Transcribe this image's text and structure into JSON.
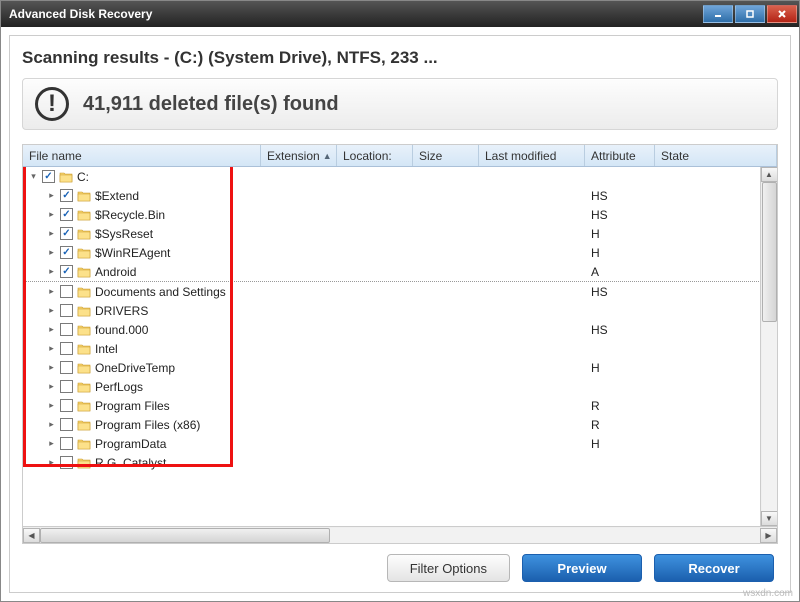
{
  "window": {
    "title": "Advanced Disk Recovery"
  },
  "heading": "Scanning results - (C:)  (System Drive), NTFS, 233 ...",
  "summary": "41,911 deleted file(s) found",
  "columns": {
    "name": "File name",
    "ext": "Extension",
    "loc": "Location:",
    "size": "Size",
    "mod": "Last modified",
    "attr": "Attribute",
    "state": "State"
  },
  "rows": [
    {
      "indent": 0,
      "expander": "▾",
      "checked": true,
      "name": "C:",
      "attr": ""
    },
    {
      "indent": 1,
      "expander": "▸",
      "checked": true,
      "name": "$Extend",
      "attr": "HS"
    },
    {
      "indent": 1,
      "expander": "▸",
      "checked": true,
      "name": "$Recycle.Bin",
      "attr": "HS"
    },
    {
      "indent": 1,
      "expander": "▸",
      "checked": true,
      "name": "$SysReset",
      "attr": "H"
    },
    {
      "indent": 1,
      "expander": "▸",
      "checked": true,
      "name": "$WinREAgent",
      "attr": "H"
    },
    {
      "indent": 1,
      "expander": "▸",
      "checked": true,
      "name": "Android",
      "attr": "A",
      "sep": true
    },
    {
      "indent": 1,
      "expander": "▸",
      "checked": false,
      "name": "Documents and Settings",
      "attr": "HS"
    },
    {
      "indent": 1,
      "expander": "▸",
      "checked": false,
      "name": "DRIVERS",
      "attr": ""
    },
    {
      "indent": 1,
      "expander": "▸",
      "checked": false,
      "name": "found.000",
      "attr": "HS"
    },
    {
      "indent": 1,
      "expander": "▸",
      "checked": false,
      "name": "Intel",
      "attr": ""
    },
    {
      "indent": 1,
      "expander": "▸",
      "checked": false,
      "name": "OneDriveTemp",
      "attr": "H"
    },
    {
      "indent": 1,
      "expander": "▸",
      "checked": false,
      "name": "PerfLogs",
      "attr": ""
    },
    {
      "indent": 1,
      "expander": "▸",
      "checked": false,
      "name": "Program Files",
      "attr": "R"
    },
    {
      "indent": 1,
      "expander": "▸",
      "checked": false,
      "name": "Program Files (x86)",
      "attr": "R"
    },
    {
      "indent": 1,
      "expander": "▸",
      "checked": false,
      "name": "ProgramData",
      "attr": "H"
    },
    {
      "indent": 1,
      "expander": "▸",
      "checked": false,
      "name": "R.G. Catalyst",
      "attr": ""
    }
  ],
  "buttons": {
    "filter": "Filter Options",
    "preview": "Preview",
    "recover": "Recover"
  },
  "watermark": "wsxdn.com"
}
